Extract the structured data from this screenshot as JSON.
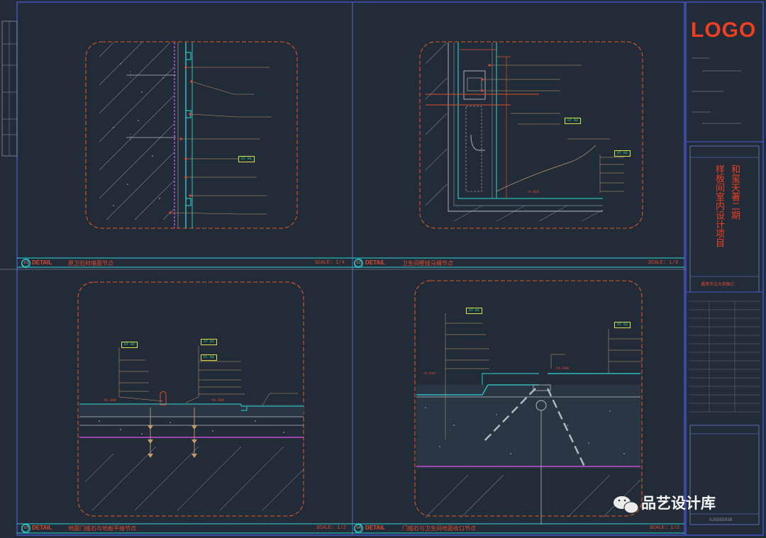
{
  "title_block": {
    "logo": "LOGO",
    "project_title": [
      "和玺天著二期",
      "样板间室内设计项目"
    ],
    "sheet_name": "通用节点大样图三",
    "drawing_no": "SJ0302030"
  },
  "panels": [
    {
      "num": "01",
      "detail": "DETAIL",
      "title": "原卫石材墙面节点",
      "scale": "SCALE: 1/4"
    },
    {
      "num": "02",
      "detail": "DETAIL",
      "title": "卫生间壁挂马桶节点",
      "scale": "SCALE: 1/3"
    },
    {
      "num": "03",
      "detail": "DETAIL",
      "title": "地面门槛石与地板平接节点",
      "scale": "SCALE: 1/2"
    },
    {
      "num": "04",
      "detail": "DETAIL",
      "title": "门槛石与卫生间地面收口节点",
      "scale": "SCALE: 1/2"
    }
  ],
  "tags": [
    "ST 01",
    "ST 01",
    "ST 02",
    "ST 01",
    "ST 02",
    "FL 01",
    "ST 01",
    "ST 02"
  ],
  "levels": [
    "-0.010",
    "±0.000",
    "±0.000",
    "-0.010",
    "±0.000"
  ],
  "watermark": {
    "text": "品艺设计库"
  }
}
